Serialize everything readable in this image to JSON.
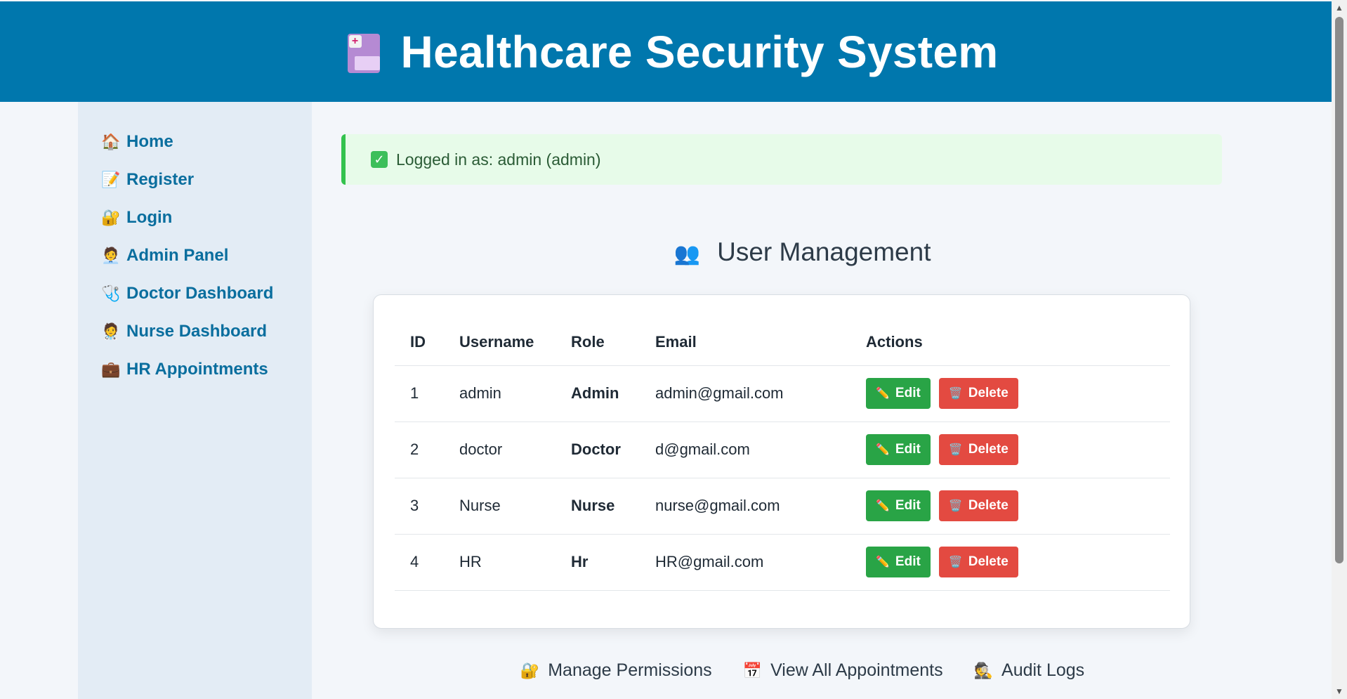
{
  "header": {
    "title": "Healthcare Security System"
  },
  "sidebar": {
    "items": [
      {
        "label": "Home",
        "icon": "🏠"
      },
      {
        "label": "Register",
        "icon": "📝"
      },
      {
        "label": "Login",
        "icon": "🔐"
      },
      {
        "label": "Admin Panel",
        "icon": "🧑‍💼"
      },
      {
        "label": "Doctor Dashboard",
        "icon": "🩺"
      },
      {
        "label": "Nurse Dashboard",
        "icon": "🧑‍⚕️"
      },
      {
        "label": "HR Appointments",
        "icon": "💼"
      }
    ]
  },
  "alert": {
    "icon": "✓",
    "text": "Logged in as: admin (admin)"
  },
  "section": {
    "title": "User Management",
    "icon": "👥"
  },
  "table": {
    "headers": {
      "id": "ID",
      "username": "Username",
      "role": "Role",
      "email": "Email",
      "actions": "Actions"
    },
    "rows": [
      {
        "id": "1",
        "username": "admin",
        "role": "Admin",
        "email": "admin@gmail.com"
      },
      {
        "id": "2",
        "username": "doctor",
        "role": "Doctor",
        "email": "d@gmail.com"
      },
      {
        "id": "3",
        "username": "Nurse",
        "role": "Nurse",
        "email": "nurse@gmail.com"
      },
      {
        "id": "4",
        "username": "HR",
        "role": "Hr",
        "email": "HR@gmail.com"
      }
    ],
    "edit_label": "Edit",
    "delete_label": "Delete",
    "edit_icon": "✏️",
    "delete_icon": "🗑️"
  },
  "links": {
    "permissions": {
      "label": "Manage Permissions",
      "icon": "🔐"
    },
    "appointments": {
      "label": "View All Appointments",
      "icon": "📅"
    },
    "audit": {
      "label": "Audit Logs",
      "icon": "🕵️"
    }
  },
  "colors": {
    "header_bg": "#0077ad",
    "sidebar_bg": "#e3ecf5",
    "nav_text": "#0a6e9e",
    "alert_bg": "#e7fbe9",
    "alert_border": "#33c24d",
    "edit_btn": "#29a446",
    "delete_btn": "#e34a41"
  }
}
